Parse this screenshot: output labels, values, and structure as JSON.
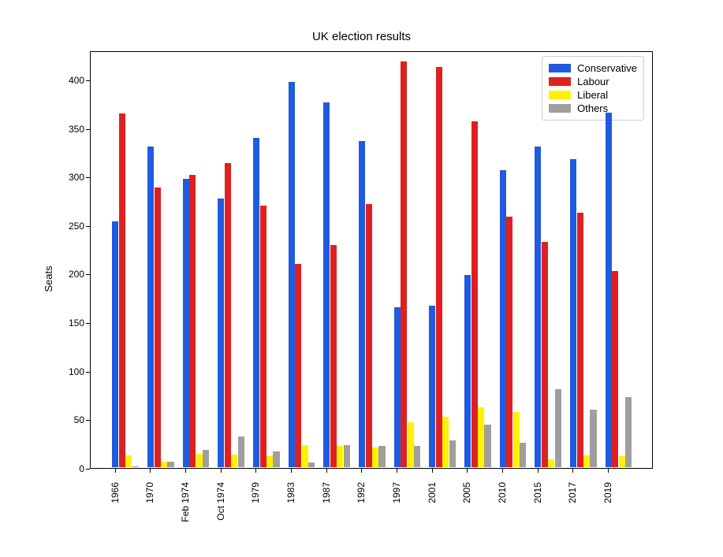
{
  "chart_data": {
    "type": "bar",
    "title": "UK election results",
    "xlabel": "",
    "ylabel": "Seats",
    "ylim": [
      0,
      430
    ],
    "yticks": [
      0,
      50,
      100,
      150,
      200,
      250,
      300,
      350,
      400
    ],
    "categories": [
      "1966",
      "1970",
      "Feb 1974",
      "Oct 1974",
      "1979",
      "1983",
      "1987",
      "1992",
      "1997",
      "2001",
      "2005",
      "2010",
      "2015",
      "2017",
      "2019"
    ],
    "series": [
      {
        "name": "Conservative",
        "color": "#1f5be0",
        "values": [
          253,
          330,
          297,
          277,
          339,
          397,
          376,
          336,
          165,
          166,
          198,
          306,
          330,
          317,
          365
        ]
      },
      {
        "name": "Labour",
        "color": "#e02020",
        "values": [
          364,
          288,
          301,
          313,
          269,
          209,
          229,
          271,
          418,
          412,
          356,
          258,
          232,
          262,
          202
        ]
      },
      {
        "name": "Liberal",
        "color": "#fff200",
        "values": [
          12,
          6,
          14,
          13,
          11,
          23,
          22,
          20,
          46,
          52,
          62,
          57,
          8,
          12,
          11
        ]
      },
      {
        "name": "Others",
        "color": "#9f9f9f",
        "values": [
          1,
          6,
          18,
          32,
          16,
          5,
          23,
          22,
          22,
          28,
          44,
          25,
          80,
          59,
          72
        ]
      }
    ],
    "legend_position": "upper right",
    "grid": false
  }
}
